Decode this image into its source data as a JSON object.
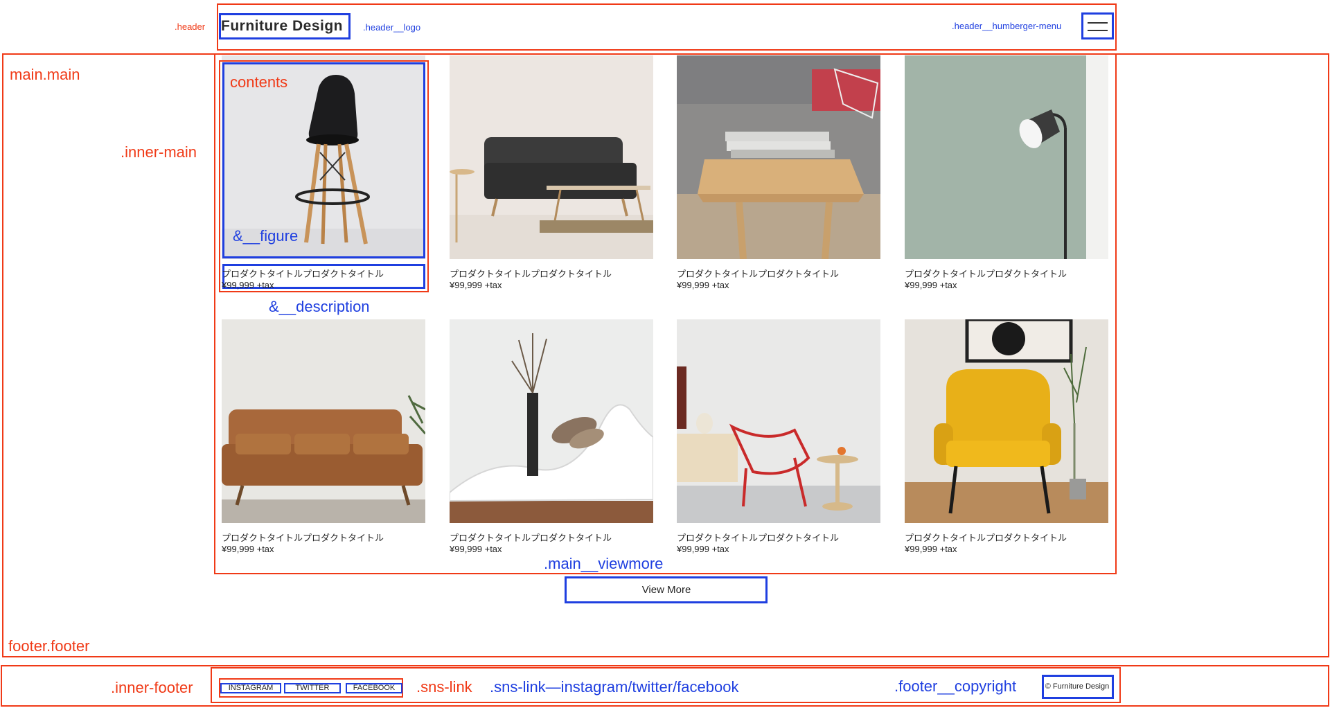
{
  "header": {
    "logo_text": "Furniture Design",
    "label_header": ".header",
    "label_logo": ".header__logo",
    "label_menu": ".header__humberger-menu"
  },
  "labels": {
    "main": "main.main",
    "inner_main": ".inner-main",
    "contents": "contents",
    "figure": "&__figure",
    "description": "&__description",
    "viewmore": ".main__viewmore",
    "footer": "footer.footer",
    "inner_footer": ".inner-footer",
    "sns_link": ".sns-link",
    "sns_link_mod": ".sns-link—instagram/twitter/facebook",
    "copyright": ".footer__copyright"
  },
  "products": [
    {
      "title": "プロダクトタイトルプロダクトタイトル",
      "price": "¥99,999 +tax"
    },
    {
      "title": "プロダクトタイトルプロダクトタイトル",
      "price": "¥99,999 +tax"
    },
    {
      "title": "プロダクトタイトルプロダクトタイトル",
      "price": "¥99,999 +tax"
    },
    {
      "title": "プロダクトタイトルプロダクトタイトル",
      "price": "¥99,999 +tax"
    },
    {
      "title": "プロダクトタイトルプロダクトタイトル",
      "price": "¥99,999 +tax"
    },
    {
      "title": "プロダクトタイトルプロダクトタイトル",
      "price": "¥99,999 +tax"
    },
    {
      "title": "プロダクトタイトルプロダクトタイトル",
      "price": "¥99,999 +tax"
    },
    {
      "title": "プロダクトタイトルプロダクトタイトル",
      "price": "¥99,999 +tax"
    }
  ],
  "viewmore_label": "View More",
  "sns": {
    "instagram": "INSTAGRAM",
    "twitter": "TWITTER",
    "facebook": "FACEBOOK"
  },
  "copyright": "© Furniture Design",
  "colors": {
    "annotation_red": "#f03a17",
    "annotation_blue": "#1f3fe0"
  }
}
